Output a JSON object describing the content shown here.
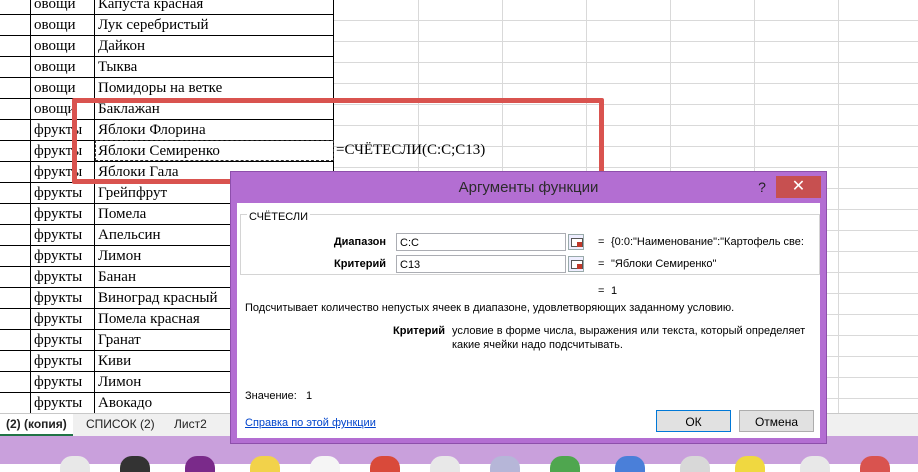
{
  "sheet": {
    "rows": [
      {
        "cat": "овощи",
        "name": "Капуста красная"
      },
      {
        "cat": "овощи",
        "name": "Лук серебристый"
      },
      {
        "cat": "овощи",
        "name": "Дайкон"
      },
      {
        "cat": "овощи",
        "name": "Тыква"
      },
      {
        "cat": "овощи",
        "name": "Помидоры на ветке"
      },
      {
        "cat": "овощи",
        "name": "Баклажан"
      },
      {
        "cat": "фрукты",
        "name": "Яблоки Флорина"
      },
      {
        "cat": "фрукты",
        "name": "Яблоки Семиренко"
      },
      {
        "cat": "фрукты",
        "name": "Яблоки Гала"
      },
      {
        "cat": "фрукты",
        "name": "Грейпфрут"
      },
      {
        "cat": "фрукты",
        "name": "Помела"
      },
      {
        "cat": "фрукты",
        "name": "Апельсин"
      },
      {
        "cat": "фрукты",
        "name": "Лимон"
      },
      {
        "cat": "фрукты",
        "name": "Банан"
      },
      {
        "cat": "фрукты",
        "name": "Виноград  красный"
      },
      {
        "cat": "фрукты",
        "name": "Помела красная"
      },
      {
        "cat": "фрукты",
        "name": "Гранат"
      },
      {
        "cat": "фрукты",
        "name": "Киви"
      },
      {
        "cat": "фрукты",
        "name": "Лимон"
      },
      {
        "cat": "фрукты",
        "name": "Авокадо"
      }
    ],
    "formula": "=СЧЁТЕСЛИ(C:C;C13)"
  },
  "tabs": [
    {
      "label": "(2) (копия)",
      "active": true
    },
    {
      "label": "СПИСОК (2)",
      "active": false
    },
    {
      "label": "Лист2",
      "active": false
    }
  ],
  "dialog": {
    "title": "Аргументы функции",
    "help_glyph": "?",
    "close_glyph": "✕",
    "function_name": "СЧЁТЕСЛИ",
    "args": [
      {
        "label": "Диапазон",
        "value": "C:C",
        "result": "{0:0:\"Наименование\":\"Картофель све:"
      },
      {
        "label": "Критерий",
        "value": "C13",
        "result": "\"Яблоки Семиренко\""
      }
    ],
    "eq_sign": "=",
    "total_result": "1",
    "description": "Подсчитывает количество непустых ячеек в диапазоне, удовлетворяющих заданному условию.",
    "arg_help_label": "Критерий",
    "arg_help_text_1": "условие в форме числа, выражения или текста, который определяет",
    "arg_help_text_2": "какие ячейки надо подсчитывать.",
    "value_label": "Значение:",
    "value": "1",
    "help_link": "Справка по этой функции",
    "ok_label": "ОК",
    "cancel_label": "Отмена"
  },
  "colors": {
    "dialog_frame": "#b36ed2",
    "highlight_box": "#d9534f",
    "taskbar": "#c9a0dc"
  }
}
